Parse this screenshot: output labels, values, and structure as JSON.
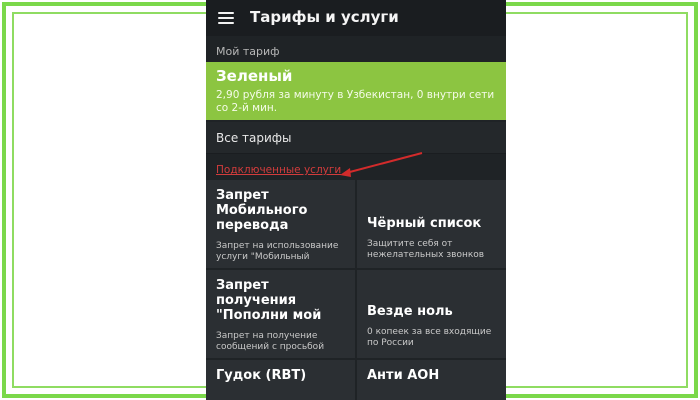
{
  "colors": {
    "frame": "#7bd84a",
    "phone_bg": "#1f2326",
    "plan_green": "#8cc541",
    "link_red": "#d23c3c"
  },
  "icons": {
    "menu": "hamburger-menu-icon"
  },
  "header": {
    "title": "Тарифы и услуги"
  },
  "my_plan": {
    "section_label": "Мой тариф",
    "name": "Зеленый",
    "description": "2,90 рубля за минуту в Узбекистан, 0 внутри сети со 2-й мин."
  },
  "all_tariffs": {
    "label": "Все тарифы"
  },
  "connected_services": {
    "label": "Подключенные услуги"
  },
  "services": [
    {
      "title": "Запрет Мобильного перевода",
      "description": "Запрет на использование услуги \"Мобильный"
    },
    {
      "title": "Чёрный список",
      "description": "Защитите себя от нежелательных звонков"
    },
    {
      "title": "Запрет получения \"Пополни мой",
      "description": "Запрет на получение сообщений с просьбой"
    },
    {
      "title": "Везде ноль",
      "description": "0 копеек за все входящие по России"
    },
    {
      "title": "Гудок (RBT)",
      "description": ""
    },
    {
      "title": "Анти АОН",
      "description": ""
    }
  ]
}
